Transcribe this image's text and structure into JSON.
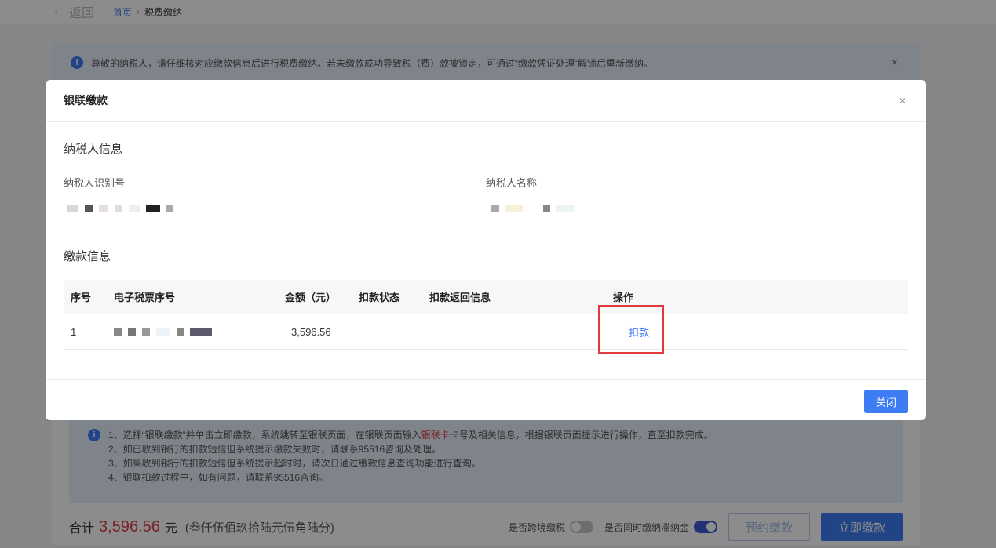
{
  "nav": {
    "back_label": "返回",
    "back_arrow": "←",
    "breadcrumb_home": "首页",
    "breadcrumb_sep": "›",
    "breadcrumb_current": "税费缴纳"
  },
  "notice": {
    "text": "尊敬的纳税人，请仔细核对应缴款信息后进行税费缴纳。若未缴款成功导致税（费）款被锁定，可通过“缴款凭证处理”解锁后重新缴纳。",
    "icon": "info-icon",
    "icon_glyph": "i",
    "close_glyph": "×"
  },
  "tips": {
    "line1_a": "1、选择“银联缴款”并单击立即缴款，系统跳转至银联页面，在银联页面输入",
    "line1_highlight": "银联卡",
    "line1_b": "卡号及相关信息，根据银联页面提示进行操作，直至扣款完成。",
    "line2": "2、如已收到银行的扣款短信但系统提示缴款失败时，请联系95516咨询及处理。",
    "line3": "3、如果收到银行的扣款短信但系统提示超时时，请次日通过缴款信息查询功能进行查询。",
    "line4": "4、银联扣款过程中，如有问题，请联系95516咨询。"
  },
  "footer": {
    "total_label": "合计",
    "total_amount": "3,596.56",
    "total_unit": "元",
    "total_in_words": "(叁仟伍佰玖拾陆元伍角陆分)",
    "cross_border_label": "是否跨境缴税",
    "cross_border_on": false,
    "late_fee_label": "是否同时缴纳滞纳金",
    "late_fee_on": true,
    "schedule_button": "预约缴款",
    "pay_now_button": "立即缴款"
  },
  "modal": {
    "title": "银联缴款",
    "close_glyph": "×",
    "taxpayer_section": "纳税人信息",
    "taxpayer_id_label": "纳税人识别号",
    "taxpayer_name_label": "纳税人名称",
    "payment_section": "缴款信息",
    "table": {
      "headers": [
        "序号",
        "电子税票序号",
        "金额（元）",
        "扣款状态",
        "扣款返回信息",
        "操作"
      ],
      "rows": [
        {
          "no": "1",
          "amount": "3,596.56",
          "status": "",
          "return_info": "",
          "action": "扣款"
        }
      ]
    },
    "close_button": "关闭"
  },
  "colors": {
    "accent": "#3d7cf4",
    "danger": "#e0414a",
    "highlight_box": "#e03a3a"
  }
}
